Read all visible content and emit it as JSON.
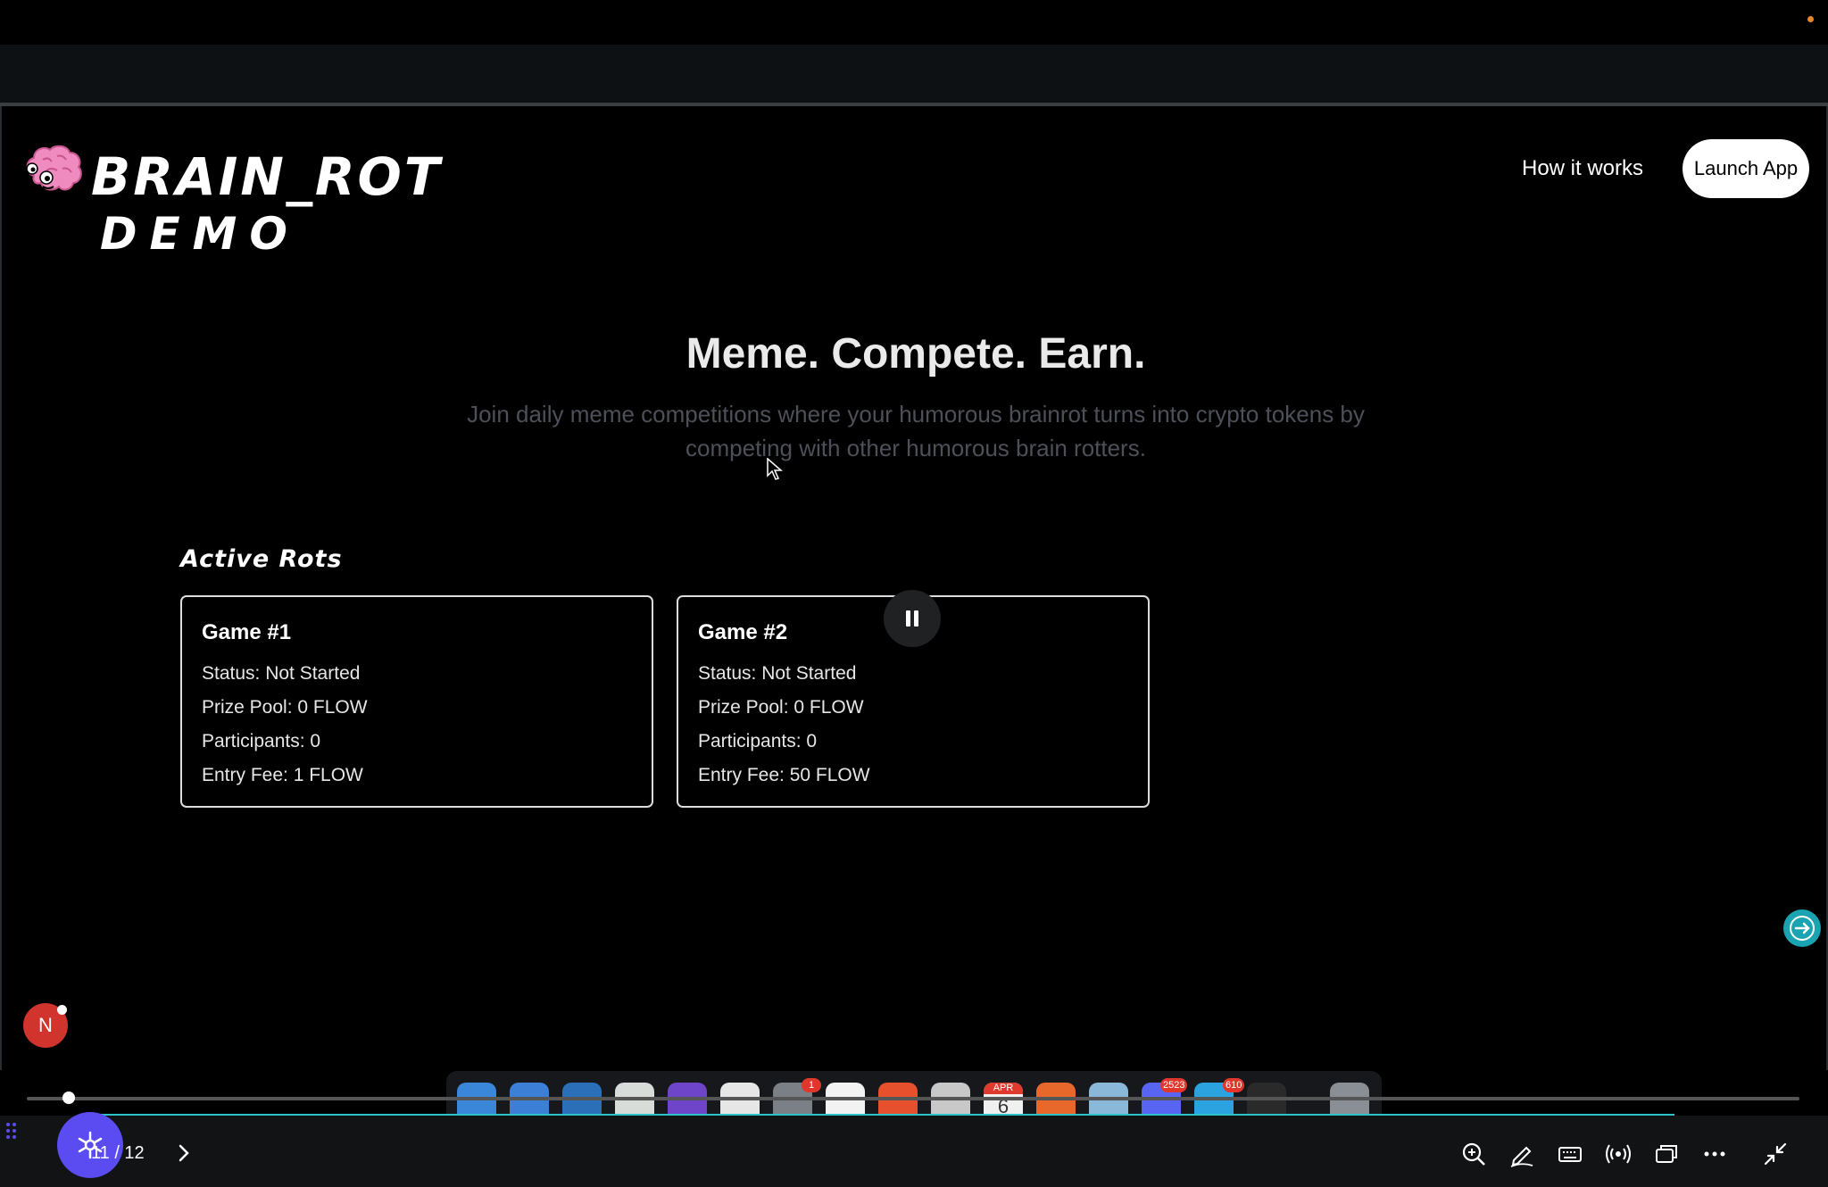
{
  "app": {
    "logo_title": "BRAIN_ROT",
    "logo_subtitle": "DEMO",
    "nav_how_it_works": "How it works",
    "launch_button": "Launch App"
  },
  "hero": {
    "title": "Meme. Compete. Earn.",
    "subtitle": "Join daily meme competitions where your humorous brainrot turns into crypto tokens by competing with other humorous brain rotters."
  },
  "active_section": {
    "title": "Active Rots",
    "games": [
      {
        "title": "Game #1",
        "status": "Status: Not Started",
        "prize_pool": "Prize Pool: 0 FLOW",
        "participants": "Participants: 0",
        "entry_fee": "Entry Fee: 1 FLOW"
      },
      {
        "title": "Game #2",
        "status": "Status: Not Started",
        "prize_pool": "Prize Pool: 0 FLOW",
        "participants": "Participants: 0",
        "entry_fee": "Entry Fee: 50 FLOW"
      }
    ]
  },
  "overlay": {
    "avatar_letter": "N",
    "page_counter": "11 / 12"
  },
  "dock": {
    "icons": [
      "finder-icon",
      "mail-icon",
      "vscode-icon",
      "gem-icon",
      "github-icon",
      "chrome-icon",
      "settings-icon",
      "notion-icon",
      "brave-icon",
      "notes-icon",
      "calendar-icon",
      "pen-icon",
      "app-icon",
      "discord-icon",
      "telegram-icon",
      "cube-icon",
      "trash-icon"
    ],
    "badges": {
      "settings": "1",
      "discord": "2523",
      "telegram": "610"
    },
    "calendar_month": "APR",
    "calendar_day": "6"
  },
  "colors": {
    "background": "#000000",
    "accent_teal": "#2cc0c9",
    "presenter_button": "#5a4cf0",
    "avatar": "#d0342c",
    "brain_pink": "#f08bc0"
  }
}
